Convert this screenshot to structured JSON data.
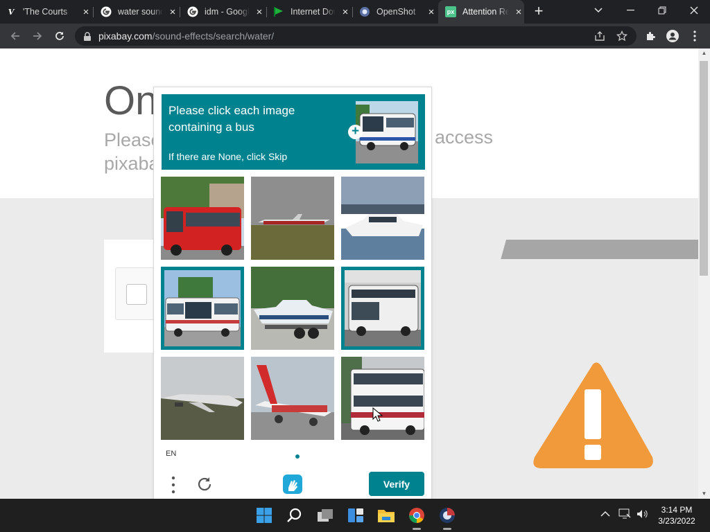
{
  "browser": {
    "tabs": [
      {
        "title": "'The Courts",
        "favicon": "v-logo-icon",
        "active": false
      },
      {
        "title": "water sound",
        "favicon": "google-icon",
        "active": false
      },
      {
        "title": "idm - Google",
        "favicon": "google-icon",
        "active": false
      },
      {
        "title": "Internet Download",
        "favicon": "idm-flag-icon",
        "active": false
      },
      {
        "title": "OpenShot",
        "favicon": "openshot-icon",
        "active": false
      },
      {
        "title": "Attention Required",
        "favicon": "pixabay-icon",
        "active": true
      }
    ],
    "url_host": "pixabay.com",
    "url_path": "/sound-effects/search/water/"
  },
  "page": {
    "heading": "On",
    "line1": "Please",
    "line1_right": "access",
    "line2": "pixaba"
  },
  "captcha": {
    "prompt_line": "Please click each image containing a bus",
    "prompt_sub": "If there are None, click Skip",
    "tiles": [
      {
        "subject": "red double-decker bus",
        "selected": false
      },
      {
        "subject": "airplane on runway",
        "selected": false
      },
      {
        "subject": "white yacht",
        "selected": false
      },
      {
        "subject": "white city bus",
        "selected": true
      },
      {
        "subject": "speedboat on trailer",
        "selected": false
      },
      {
        "subject": "white bus",
        "selected": true
      },
      {
        "subject": "airplane",
        "selected": false
      },
      {
        "subject": "red and white airliner",
        "selected": false
      },
      {
        "subject": "double-decker bus",
        "selected": false
      }
    ],
    "language": "EN",
    "verify_label": "Verify",
    "accent_color": "#00838f"
  },
  "taskbar": {
    "time": "3:14 PM",
    "date": "3/23/2022"
  }
}
